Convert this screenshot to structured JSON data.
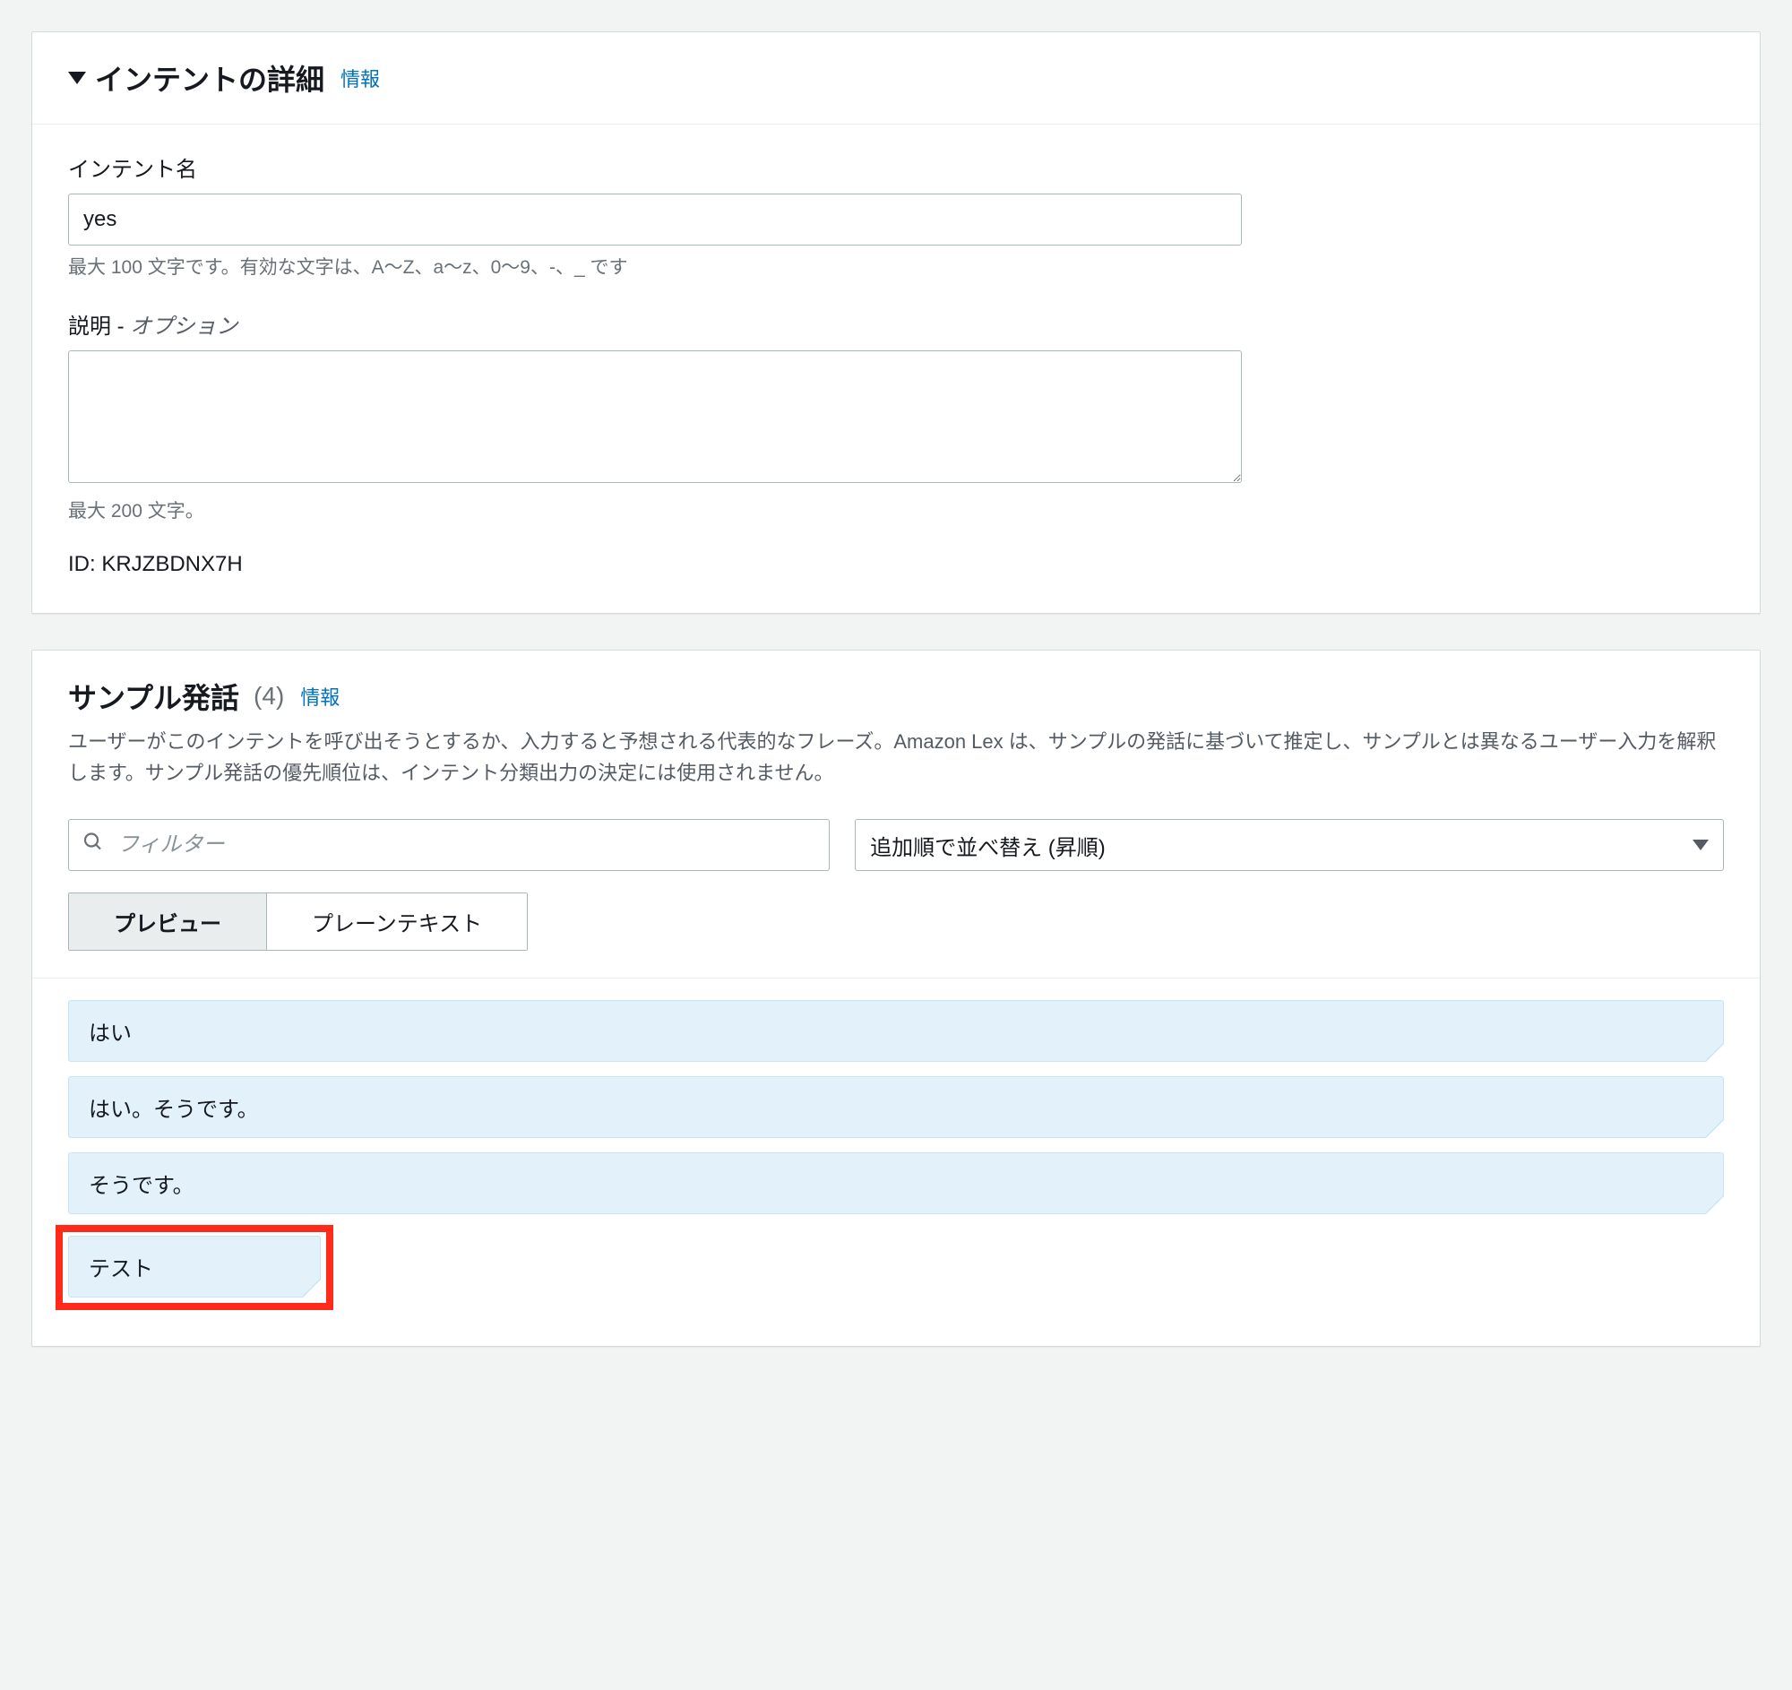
{
  "intent_details": {
    "title": "インテントの詳細",
    "info_label": "情報",
    "name_label": "インテント名",
    "name_value": "yes",
    "name_hint": "最大 100 文字です。有効な文字は、A～Z、a～z、0～9、-、_ です",
    "desc_label": "説明 - ",
    "desc_optional": "オプション",
    "desc_value": "",
    "desc_hint": "最大 200 文字。",
    "id_label": "ID: ",
    "id_value": "KRJZBDNX7H"
  },
  "sample_utterances": {
    "title": "サンプル発話",
    "count": "(4)",
    "info_label": "情報",
    "description": "ユーザーがこのインテントを呼び出そうとするか、入力すると予想される代表的なフレーズ。Amazon Lex は、サンプルの発話に基づいて推定し、サンプルとは異なるユーザー入力を解釈します。サンプル発話の優先順位は、インテント分類出力の決定には使用されません。",
    "filter_placeholder": "フィルター",
    "sort_value": "追加順で並べ替え (昇順)",
    "view_preview": "プレビュー",
    "view_plain": "プレーンテキスト",
    "items": [
      "はい",
      "はい。そうです。",
      "そうです。",
      "テスト"
    ]
  }
}
